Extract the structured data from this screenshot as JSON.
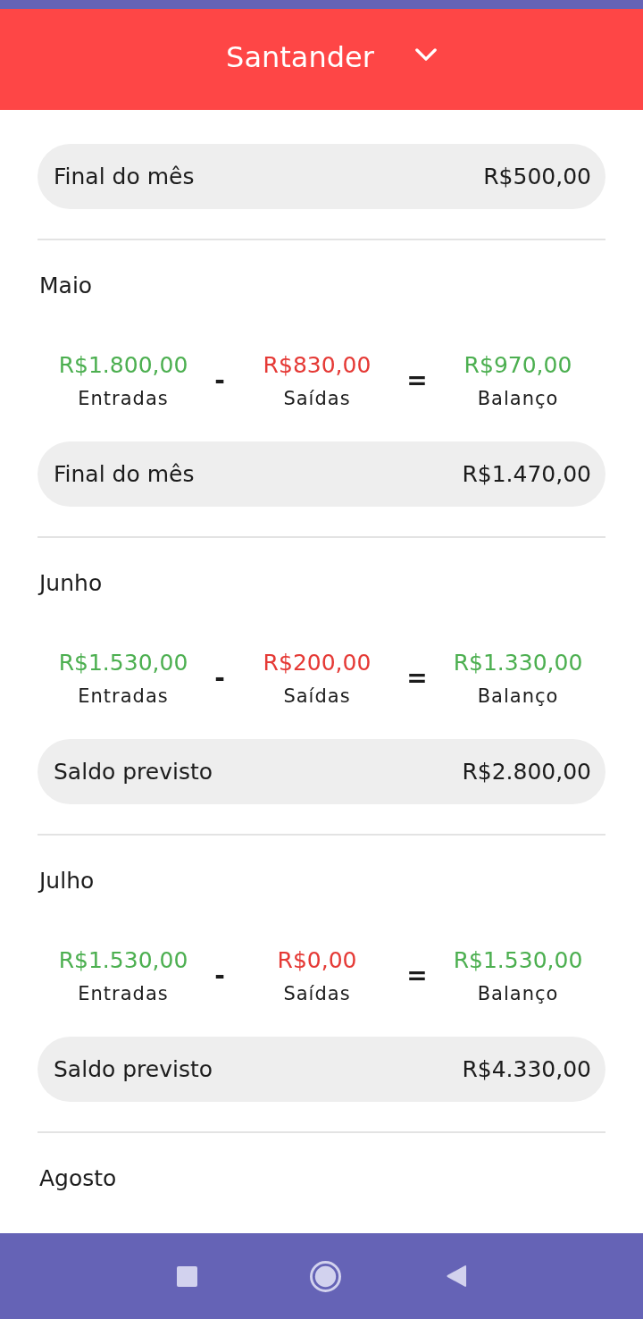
{
  "header": {
    "title": "Santander"
  },
  "months": [
    {
      "summary": {
        "label": "Final do mês",
        "value": "R$500,00"
      }
    },
    {
      "name": "Maio",
      "flow": [
        {
          "kind": "amount",
          "value": "R$1.800,00",
          "label": "Entradas",
          "color": "#4caf50"
        },
        {
          "kind": "operator",
          "symbol": "-"
        },
        {
          "kind": "amount",
          "value": "R$830,00",
          "label": "Saídas",
          "color": "#e53935"
        },
        {
          "kind": "operator",
          "symbol": "="
        },
        {
          "kind": "amount",
          "value": "R$970,00",
          "label": "Balanço",
          "color": "#4caf50"
        }
      ],
      "summary": {
        "label": "Final do mês",
        "value": "R$1.470,00"
      }
    },
    {
      "name": "Junho",
      "flow": [
        {
          "kind": "amount",
          "value": "R$1.530,00",
          "label": "Entradas",
          "color": "#4caf50"
        },
        {
          "kind": "operator",
          "symbol": "-"
        },
        {
          "kind": "amount",
          "value": "R$200,00",
          "label": "Saídas",
          "color": "#e53935"
        },
        {
          "kind": "operator",
          "symbol": "="
        },
        {
          "kind": "amount",
          "value": "R$1.330,00",
          "label": "Balanço",
          "color": "#4caf50"
        }
      ],
      "summary": {
        "label": "Saldo previsto",
        "value": "R$2.800,00"
      }
    },
    {
      "name": "Julho",
      "flow": [
        {
          "kind": "amount",
          "value": "R$1.530,00",
          "label": "Entradas",
          "color": "#4caf50"
        },
        {
          "kind": "operator",
          "symbol": "-"
        },
        {
          "kind": "amount",
          "value": "R$0,00",
          "label": "Saídas",
          "color": "#e53935"
        },
        {
          "kind": "operator",
          "symbol": "="
        },
        {
          "kind": "amount",
          "value": "R$1.530,00",
          "label": "Balanço",
          "color": "#4caf50"
        }
      ],
      "summary": {
        "label": "Saldo previsto",
        "value": "R$4.330,00"
      }
    },
    {
      "name": "Agosto"
    }
  ]
}
